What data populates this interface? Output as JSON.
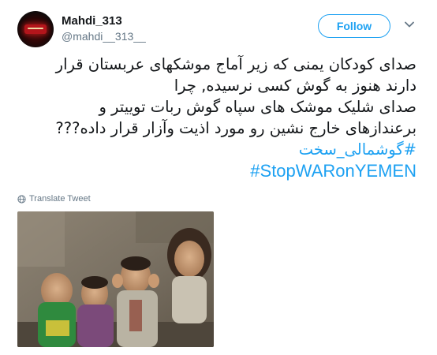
{
  "user": {
    "display_name": "Mahdi_313",
    "username": "@mahdi__313__"
  },
  "follow_label": "Follow",
  "tweet": {
    "lines": [
      "صدای کودکان یمنی که زیر آماج موشکهای عربستان قرار",
      "دارند هنوز به گوش کسی نرسیده, چرا",
      "صدای شلیک موشک های سپاه گوش ربات توییتر و",
      "برعندازهای خارج نشین رو مورد اذیت وآزار قرار داده???"
    ],
    "hashtags": [
      "#گوشمالی_سخت",
      "#StopWARonYEMEN"
    ]
  },
  "translate_label": "Translate Tweet",
  "icons": {
    "avatar": "avatar-image",
    "menu": "chevron-down-icon",
    "translate": "globe-icon"
  },
  "colors": {
    "accent": "#1da1f2",
    "text": "#14171a",
    "muted": "#657786"
  }
}
